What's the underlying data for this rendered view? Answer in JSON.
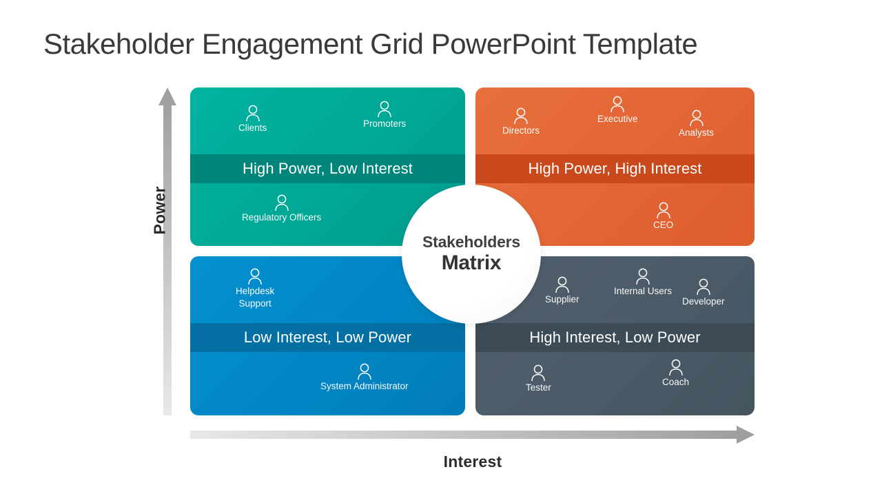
{
  "title": "Stakeholder Engagement Grid PowerPoint Template",
  "center": {
    "line1": "Stakeholders",
    "line2": "Matrix"
  },
  "axes": {
    "y_label": "Power",
    "x_label": "Interest",
    "y_arrow_direction": "up",
    "x_arrow_direction": "right",
    "arrow_color_dark": "#9a9a9a",
    "arrow_color_light": "#e2e2e2"
  },
  "quadrants": [
    {
      "id": "top-left",
      "band_label": "High Power, Low Interest",
      "base_color": "#00A694",
      "band_color": "#00857A",
      "stakeholders": [
        {
          "label": "Clients",
          "icon": "person-icon"
        },
        {
          "label": "Promoters",
          "icon": "person-icon"
        },
        {
          "label": "Regulatory Officers",
          "icon": "person-icon"
        }
      ]
    },
    {
      "id": "top-right",
      "band_label": "High Power, High Interest",
      "base_color": "#E26434",
      "band_color": "#C9491D",
      "stakeholders": [
        {
          "label": "Directors",
          "icon": "person-icon"
        },
        {
          "label": "Executive",
          "icon": "person-icon"
        },
        {
          "label": "Analysts",
          "icon": "person-icon"
        },
        {
          "label": "CEO",
          "icon": "person-icon"
        }
      ]
    },
    {
      "id": "bottom-left",
      "band_label": "Low Interest, Low Power",
      "base_color": "#0285C4",
      "band_color": "#046FA3",
      "stakeholders": [
        {
          "label": "Helpdesk Support",
          "icon": "person-icon"
        },
        {
          "label": "System Administrator",
          "icon": "person-icon"
        }
      ]
    },
    {
      "id": "bottom-right",
      "band_label": "High Interest, Low Power",
      "base_color": "#4A5A66",
      "band_color": "#3C4B56",
      "stakeholders": [
        {
          "label": "Supplier",
          "icon": "person-icon"
        },
        {
          "label": "Internal Users",
          "icon": "person-icon"
        },
        {
          "label": "Developer",
          "icon": "person-icon"
        },
        {
          "label": "Tester",
          "icon": "person-icon"
        },
        {
          "label": "Coach",
          "icon": "person-icon"
        }
      ]
    }
  ],
  "labels": {
    "helpdesk_line1": "Helpdesk",
    "helpdesk_line2": "Support"
  }
}
